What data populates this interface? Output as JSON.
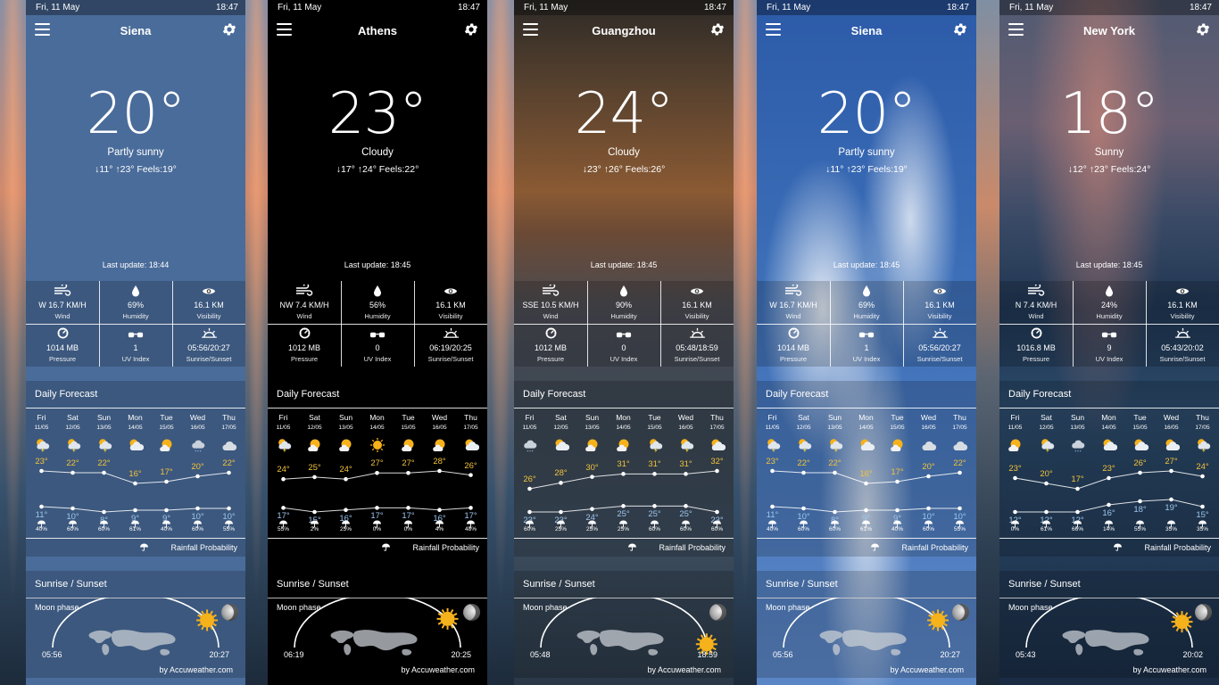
{
  "status": {
    "date": "Fri, 11 May",
    "time": "18:47"
  },
  "labels": {
    "wind": "Wind",
    "humidity": "Humidity",
    "visibility": "Visibility",
    "pressure": "Pressure",
    "uv": "UV Index",
    "sunrise_sunset": "Sunrise/Sunset",
    "daily_forecast": "Daily Forecast",
    "rainfall_probability": "Rainfall Probability",
    "sunrise_title": "Sunrise / Sunset",
    "moon_phase": "Moon phase",
    "by": "by Accuweather.com"
  },
  "days": [
    {
      "name": "Fri",
      "date": "11/05"
    },
    {
      "name": "Sat",
      "date": "12/05"
    },
    {
      "name": "Sun",
      "date": "13/05"
    },
    {
      "name": "Mon",
      "date": "14/05"
    },
    {
      "name": "Tue",
      "date": "15/05"
    },
    {
      "name": "Wed",
      "date": "16/05"
    },
    {
      "name": "Thu",
      "date": "17/05"
    }
  ],
  "screens": [
    {
      "theme": "siena",
      "city": "Siena",
      "temp": "20°",
      "condition": "Partly sunny",
      "range": "↓11° ↑23° Feels:19°",
      "last_update": "Last update: 18:44",
      "wind": "W 16.7 KM/H",
      "humidity": "69%",
      "visibility": "16.1 KM",
      "pressure": "1014 MB",
      "uv": "1",
      "sun": "05:56/20:27",
      "forecast_icons": [
        "partly-cloudy-thunder",
        "partly-cloudy-thunder",
        "partly-cloudy-thunder",
        "partly-cloudy",
        "sunny-cloud",
        "cloudy-rain",
        "cloudy"
      ],
      "highs": [
        "23°",
        "22°",
        "22°",
        "16°",
        "17°",
        "20°",
        "22°"
      ],
      "lows": [
        "11°",
        "10°",
        "8°",
        "9°",
        "9°",
        "10°",
        "10°"
      ],
      "rain": [
        "40%",
        "60%",
        "60%",
        "61%",
        "40%",
        "60%",
        "55%"
      ],
      "sunrise": "05:56",
      "sunset": "20:27",
      "sun_progress": 0.83
    },
    {
      "theme": "athens",
      "city": "Athens",
      "temp": "23°",
      "condition": "Cloudy",
      "range": "↓17° ↑24° Feels:22°",
      "last_update": "Last update: 18:45",
      "wind": "NW 7.4 KM/H",
      "humidity": "56%",
      "visibility": "16.1 KM",
      "pressure": "1012 MB",
      "uv": "0",
      "sun": "06:19/20:25",
      "forecast_icons": [
        "partly-cloudy-thunder",
        "sunny-cloud",
        "sunny-cloud",
        "sunny",
        "sunny-cloud",
        "sunny-cloud",
        "partly-cloudy"
      ],
      "highs": [
        "24°",
        "25°",
        "24°",
        "27°",
        "27°",
        "28°",
        "26°"
      ],
      "lows": [
        "17°",
        "15°",
        "16°",
        "17°",
        "17°",
        "16°",
        "17°"
      ],
      "rain": [
        "55%",
        "2%",
        "25%",
        "0%",
        "0%",
        "4%",
        "48%"
      ],
      "sunrise": "06:19",
      "sunset": "20:25",
      "sun_progress": 0.82
    },
    {
      "theme": "guangzhou",
      "city": "Guangzhou",
      "temp": "24°",
      "condition": "Cloudy",
      "range": "↓23° ↑26° Feels:26°",
      "last_update": "Last update: 18:45",
      "wind": "SSE 10.5 KM/H",
      "humidity": "90%",
      "visibility": "16.1 KM",
      "pressure": "1012 MB",
      "uv": "0",
      "sun": "05:48/18:59",
      "forecast_icons": [
        "cloudy-rain",
        "partly-cloudy",
        "sunny-cloud",
        "sunny-cloud",
        "partly-cloudy-thunder",
        "partly-cloudy-thunder",
        "partly-cloudy"
      ],
      "highs": [
        "26°",
        "28°",
        "30°",
        "31°",
        "31°",
        "31°",
        "32°"
      ],
      "lows": [
        "23°",
        "23°",
        "24°",
        "25°",
        "25°",
        "25°",
        "23°"
      ],
      "rain": [
        "60%",
        "25%",
        "25%",
        "25%",
        "60%",
        "60%",
        "60%"
      ],
      "sunrise": "05:48",
      "sunset": "18:59",
      "sun_progress": 0.98
    },
    {
      "theme": "siena2",
      "city": "Siena",
      "temp": "20°",
      "condition": "Partly sunny",
      "range": "↓11° ↑23° Feels:19°",
      "last_update": "Last update: 18:45",
      "wind": "W 16.7 KM/H",
      "humidity": "69%",
      "visibility": "16.1 KM",
      "pressure": "1014 MB",
      "uv": "1",
      "sun": "05:56/20:27",
      "forecast_icons": [
        "partly-cloudy-thunder",
        "partly-cloudy-thunder",
        "partly-cloudy-thunder",
        "partly-cloudy",
        "sunny-cloud",
        "cloudy",
        "cloudy"
      ],
      "highs": [
        "23°",
        "22°",
        "22°",
        "16°",
        "17°",
        "20°",
        "22°"
      ],
      "lows": [
        "11°",
        "10°",
        "8°",
        "9°",
        "9°",
        "10°",
        "10°"
      ],
      "rain": [
        "40%",
        "60%",
        "60%",
        "61%",
        "40%",
        "60%",
        "55%"
      ],
      "sunrise": "05:56",
      "sunset": "20:27",
      "sun_progress": 0.83
    },
    {
      "theme": "newyork",
      "city": "New York",
      "temp": "18°",
      "condition": "Sunny",
      "range": "↓12° ↑23° Feels:24°",
      "last_update": "Last update: 18:45",
      "wind": "N 7.4 KM/H",
      "humidity": "24%",
      "visibility": "16.1 KM",
      "pressure": "1016.8 MB",
      "uv": "9",
      "sun": "05:43/20:02",
      "forecast_icons": [
        "sunny-cloud",
        "partly-cloudy-thunder",
        "cloudy-rain",
        "partly-cloudy",
        "partly-cloudy",
        "partly-cloudy",
        "partly-cloudy-thunder"
      ],
      "highs": [
        "23°",
        "20°",
        "17°",
        "23°",
        "26°",
        "27°",
        "24°"
      ],
      "lows": [
        "12°",
        "12°",
        "12°",
        "16°",
        "18°",
        "19°",
        "15°"
      ],
      "rain": [
        "0%",
        "61%",
        "66%",
        "14%",
        "55%",
        "35%",
        "35%"
      ],
      "sunrise": "05:43",
      "sunset": "20:02",
      "sun_progress": 0.84
    }
  ]
}
